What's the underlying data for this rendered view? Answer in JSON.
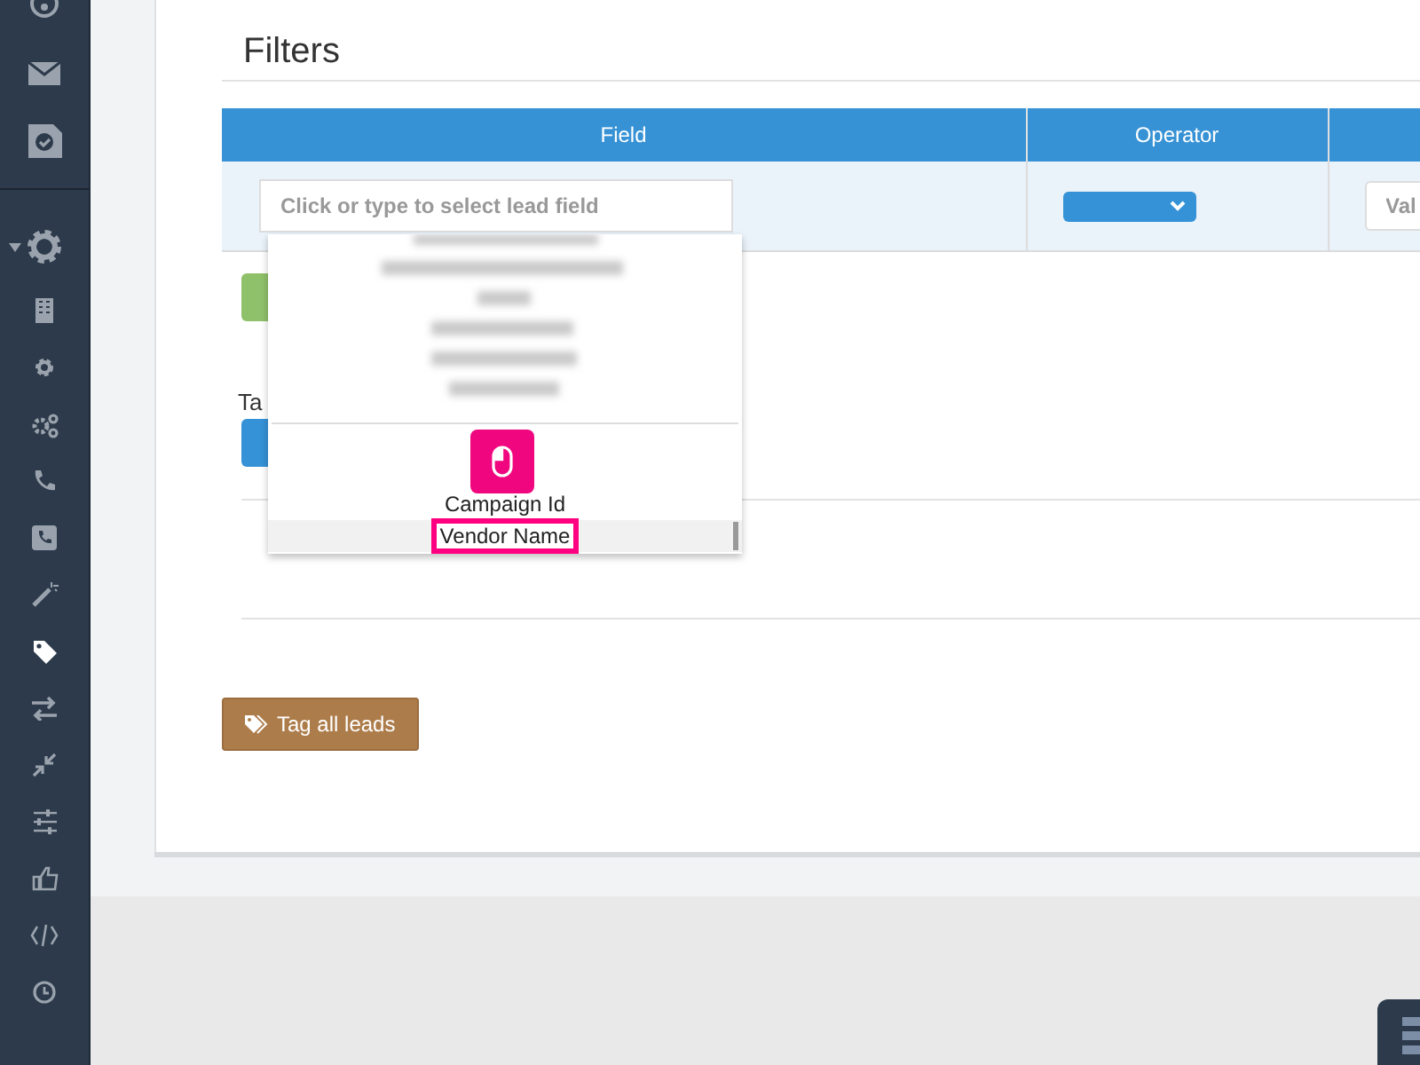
{
  "sidebar": {
    "items": [
      {
        "selected": false
      },
      {
        "selected": false
      },
      {
        "selected": false
      },
      {
        "selected": false,
        "expanded": true
      },
      {
        "selected": false
      },
      {
        "selected": false
      },
      {
        "selected": false
      },
      {
        "selected": false
      },
      {
        "selected": false
      },
      {
        "selected": false
      },
      {
        "selected": true
      },
      {
        "selected": false
      },
      {
        "selected": false
      },
      {
        "selected": false
      },
      {
        "selected": false
      },
      {
        "selected": false
      },
      {
        "selected": false
      }
    ]
  },
  "filters": {
    "title": "Filters",
    "columns": [
      "Field",
      "Operator"
    ],
    "field": {
      "placeholder": "Click or type to select lead field"
    },
    "value": {
      "placeholder": "Val"
    },
    "options": [
      {
        "label": "Campaign Id",
        "selected": false
      },
      {
        "label": "Vendor Name",
        "selected": true
      }
    ]
  },
  "tags_label": "Ta",
  "tag_button": "Tag all leads"
}
